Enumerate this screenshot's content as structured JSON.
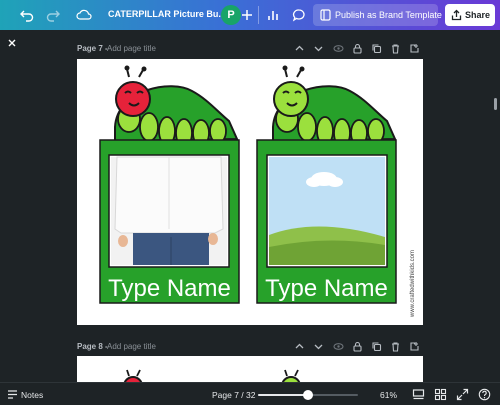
{
  "toolbar": {
    "doc_title": "CATERPILLAR Picture Bu...",
    "avatar_initial": "P",
    "publish_label": "Publish as Brand Template",
    "share_label": "Share"
  },
  "pages": [
    {
      "name": "Page 7 -",
      "title_placeholder": "Add page title"
    },
    {
      "name": "Page 8 -",
      "title_placeholder": "Add page title"
    }
  ],
  "design": {
    "cards": [
      {
        "name_text": "Type Name"
      },
      {
        "name_text": "Type Name"
      }
    ],
    "watermark": "www.craftedwithkids.com",
    "colors": {
      "green": "#27a12a",
      "dark_green": "#1e7a1f",
      "lime": "#9be03d",
      "red": "#e6223a"
    }
  },
  "bottombar": {
    "notes_label": "Notes",
    "page_indicator": "Page 7 / 32",
    "zoom_label": "61%",
    "zoom_fraction": 0.5
  },
  "icons": [
    "undo-icon",
    "redo-icon",
    "cloud-icon",
    "plus-icon",
    "stats-icon",
    "comment-icon",
    "publish-icon",
    "share-icon",
    "close-icon",
    "chevron-up-icon",
    "chevron-down-icon",
    "hide-icon",
    "lock-icon",
    "duplicate-icon",
    "delete-icon",
    "add-page-icon",
    "notes-icon",
    "pages-view-icon",
    "grid-view-icon",
    "fullscreen-icon",
    "help-icon"
  ]
}
